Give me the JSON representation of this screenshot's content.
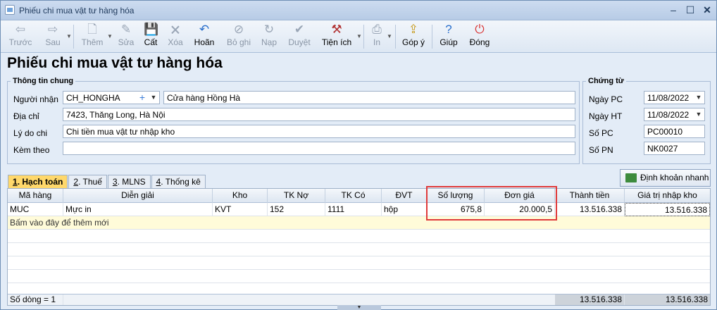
{
  "window": {
    "title": "Phiếu chi mua vật tư hàng hóa"
  },
  "toolbar": [
    {
      "label": "Trước",
      "icon": "arrow-left-icon",
      "enabled": false
    },
    {
      "label": "Sau",
      "icon": "arrow-right-icon",
      "enabled": false
    },
    {
      "label": "Thêm",
      "icon": "new-document-icon",
      "enabled": false
    },
    {
      "label": "Sửa",
      "icon": "edit-document-icon",
      "enabled": false
    },
    {
      "label": "Cất",
      "icon": "save-icon",
      "enabled": true
    },
    {
      "label": "Xóa",
      "icon": "delete-icon",
      "enabled": false
    },
    {
      "label": "Hoãn",
      "icon": "undo-icon",
      "enabled": true
    },
    {
      "label": "Bỏ ghi",
      "icon": "unpost-icon",
      "enabled": false
    },
    {
      "label": "Nạp",
      "icon": "reload-icon",
      "enabled": false
    },
    {
      "label": "Duyệt",
      "icon": "approve-check-icon",
      "enabled": false
    },
    {
      "label": "Tiện ích",
      "icon": "tools-icon",
      "enabled": true
    },
    {
      "label": "In",
      "icon": "printer-icon",
      "enabled": false
    },
    {
      "label": "Góp ý",
      "icon": "feedback-icon",
      "enabled": true
    },
    {
      "label": "Giúp",
      "icon": "help-icon",
      "enabled": true
    },
    {
      "label": "Đóng",
      "icon": "power-icon",
      "enabled": true
    }
  ],
  "form": {
    "heading": "Phiếu chi mua vật tư hàng hóa",
    "general": {
      "legend": "Thông tin chung",
      "recipient_label": "Người nhận",
      "recipient_code": "CH_HONGHA",
      "recipient_name": "Cửa hàng Hồng Hà",
      "address_label": "Địa chỉ",
      "address": "7423, Thăng Long, Hà Nội",
      "reason_label": "Lý do chi",
      "reason": "Chi tiền mua vật tư nhập kho",
      "attach_label": "Kèm theo",
      "attach": ""
    },
    "voucher": {
      "legend": "Chứng từ",
      "date_pc_label": "Ngày PC",
      "date_pc": "11/08/2022",
      "date_ht_label": "Ngày HT",
      "date_ht": "11/08/2022",
      "no_pc_label": "Số PC",
      "no_pc": "PC00010",
      "no_pn_label": "Số PN",
      "no_pn": "NK0027"
    }
  },
  "tabs": [
    {
      "num": "1",
      "label": ". Hạch toán",
      "active": true
    },
    {
      "num": "2",
      "label": ". Thuế",
      "active": false
    },
    {
      "num": "3",
      "label": ". MLNS",
      "active": false
    },
    {
      "num": "4",
      "label": ". Thống kê",
      "active": false
    }
  ],
  "quick_button": "Định khoản nhanh",
  "grid": {
    "columns": [
      "Mã hàng",
      "Diễn giải",
      "Kho",
      "TK Nợ",
      "TK Có",
      "ĐVT",
      "Số lượng",
      "Đơn giá",
      "Thành tiền",
      "Giá trị nhập kho"
    ],
    "rows": [
      [
        "MUC",
        "Mực in",
        "KVT",
        "152",
        "1111",
        "hộp",
        "675,8",
        "20.000,5",
        "13.516.338",
        "13.516.338"
      ]
    ],
    "new_row_hint": "Bấm vào đây để thêm mới",
    "footer": {
      "count": "Số dòng = 1",
      "total_amount": "13.516.338",
      "total_value": "13.516.338"
    }
  },
  "colors": {
    "highlight_box": "#e03a3a",
    "active_tab": "#ffd86b",
    "new_row": "#fffbd9"
  }
}
